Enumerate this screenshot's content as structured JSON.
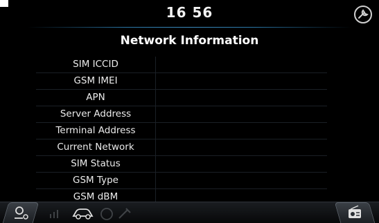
{
  "header": {
    "clock": "16 56"
  },
  "page": {
    "title": "Network Information"
  },
  "rows": [
    {
      "label": "SIM ICCID",
      "value": ""
    },
    {
      "label": "GSM IMEI",
      "value": ""
    },
    {
      "label": "APN",
      "value": ""
    },
    {
      "label": "Server Address",
      "value": ""
    },
    {
      "label": "Terminal Address",
      "value": ""
    },
    {
      "label": "Current Network",
      "value": ""
    },
    {
      "label": "SIM Status",
      "value": ""
    },
    {
      "label": "GSM Type",
      "value": ""
    },
    {
      "label": "GSM dBM",
      "value": ""
    }
  ],
  "icons": {
    "settings": "settings-wrench-icon",
    "left_nav": "driver-tools-icon",
    "car_nav": "car-service-icon",
    "right_nav": "radio-icon"
  },
  "colors": {
    "background": "#000000",
    "accent_line": "#3c8cc0",
    "text": "#ececec"
  }
}
